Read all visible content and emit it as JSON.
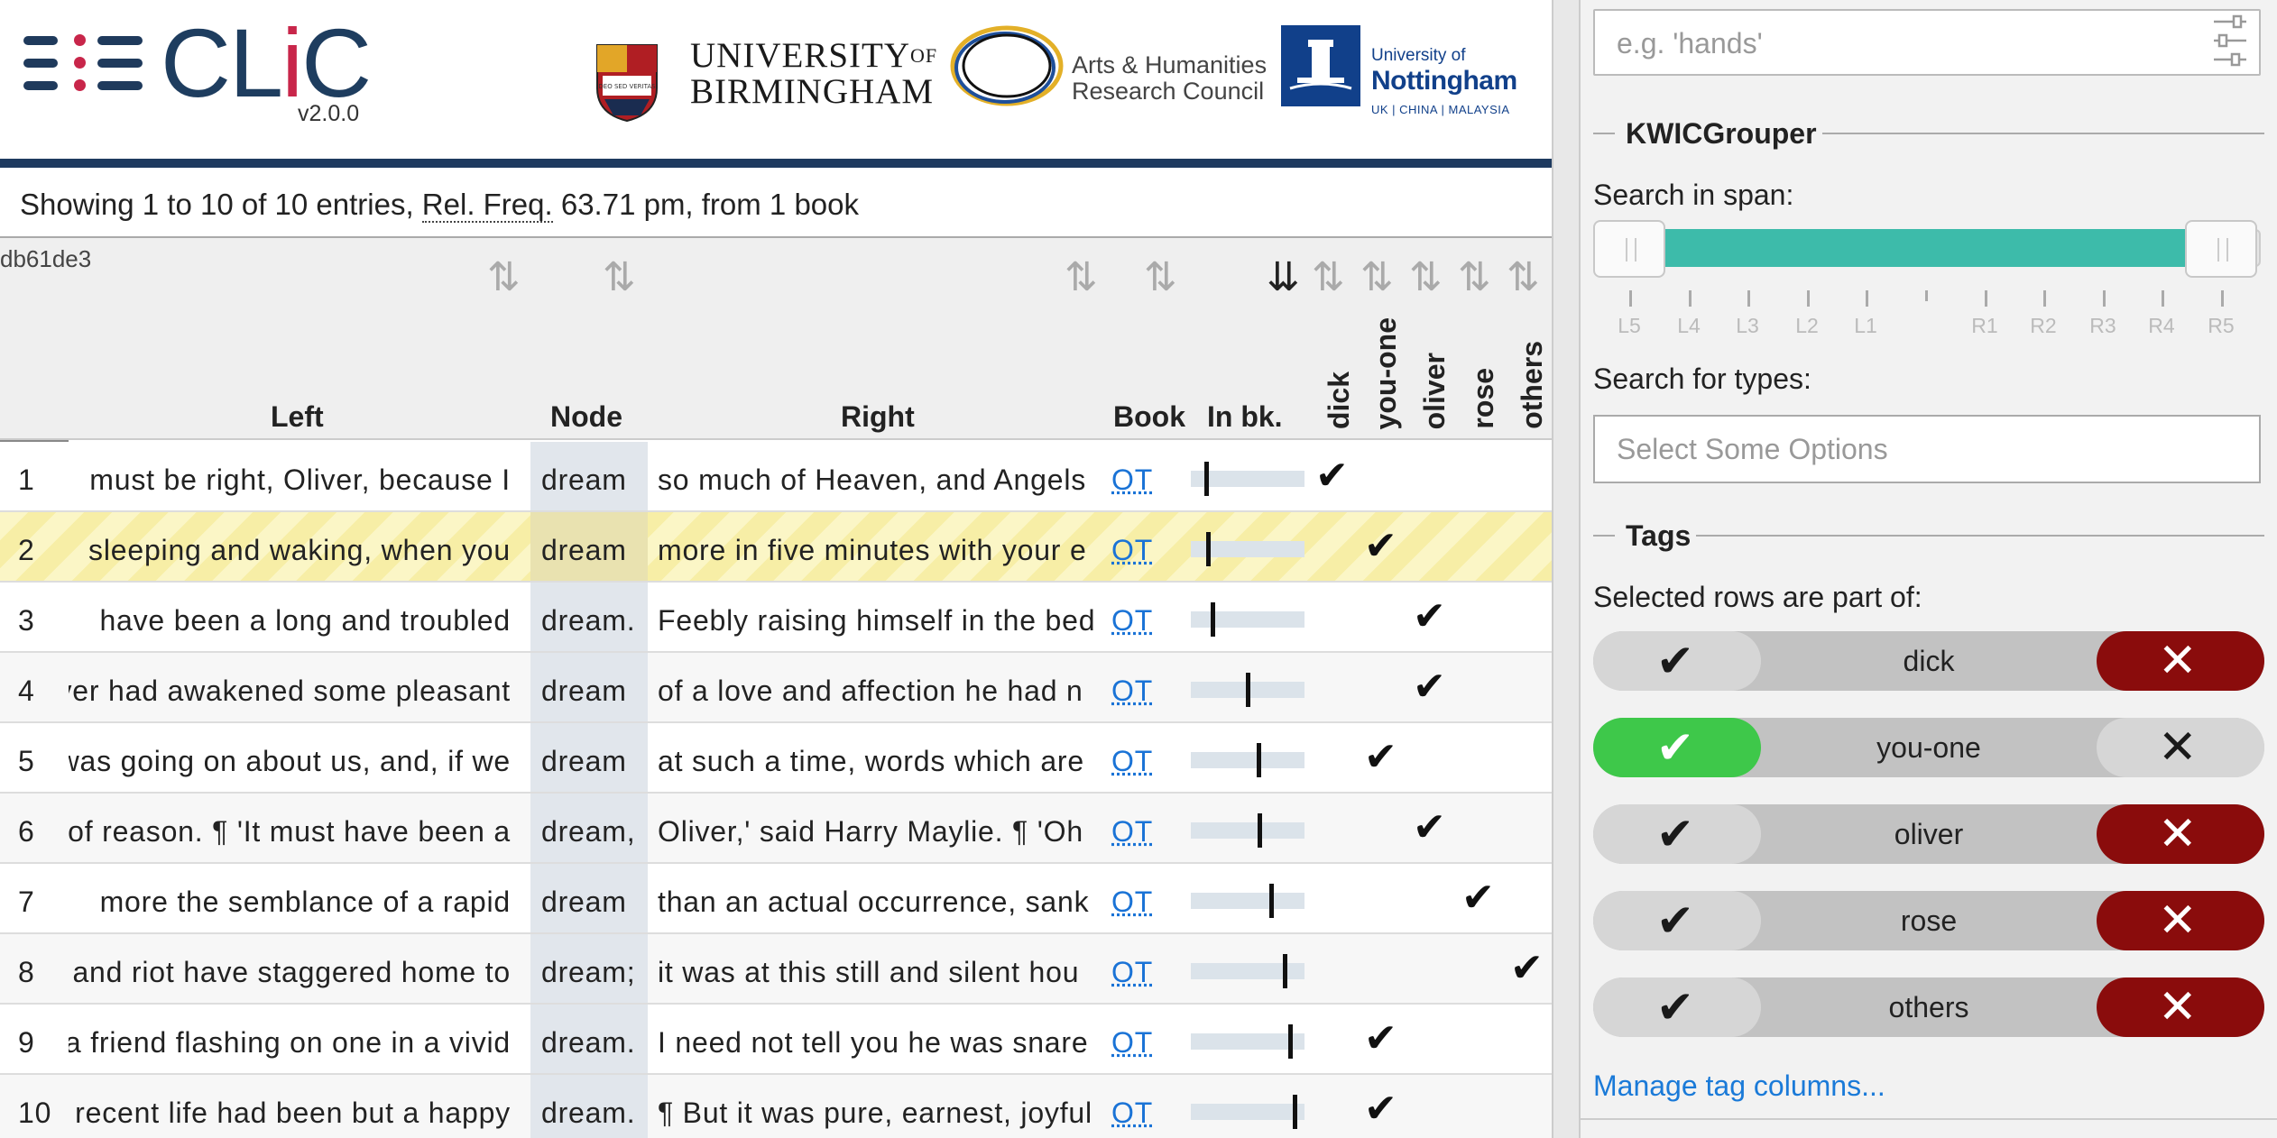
{
  "header": {
    "app_name_pre": "CL",
    "app_name_i": "i",
    "app_name_post": "C",
    "version": "v2.0.0",
    "uob_line1": "UNIVERSITY",
    "uob_of": "OF",
    "uob_line2": "BIRMINGHAM",
    "ahrc_line1": "Arts & Humanities",
    "ahrc_line2": "Research Council",
    "uon_line1": "University of",
    "uon_line2": "Nottingham",
    "uon_line3": "UK | CHINA | MALAYSIA",
    "uob_crest_text": "DEO SED VERITAS",
    "brand_color": "#1e3d5f",
    "accent_color": "#c8264a"
  },
  "info": {
    "text_prefix": "Showing 1 to 10 of 10 entries, ",
    "abbr": "Rel. Freq.",
    "text_suffix": " 63.71 pm, from 1 book"
  },
  "table": {
    "row_id": "db61de3",
    "headers": {
      "left": "Left",
      "node": "Node",
      "right": "Right",
      "book": "Book",
      "inbk": "In bk.",
      "tags": [
        "dick",
        "you-one",
        "oliver",
        "rose",
        "others"
      ]
    },
    "rows": [
      {
        "idx": "1",
        "left": "must be right, Oliver, because I",
        "node": "dream",
        "right": "so much of Heaven, and Angels",
        "book": "OT",
        "inbk": 0.12,
        "tag": 0
      },
      {
        "idx": "2",
        "left": "sleeping and waking, when you",
        "node": "dream",
        "right": "more in five minutes with your e",
        "book": "OT",
        "inbk": 0.14,
        "tag": 1
      },
      {
        "idx": "3",
        "left": "have been a long and troubled",
        "node": "dream.",
        "right": "Feebly raising himself in the bed",
        "book": "OT",
        "inbk": 0.18,
        "tag": 2
      },
      {
        "idx": "4",
        "left": "Oliver had awakened some pleasant",
        "node": "dream",
        "right": "of a love and affection he had n",
        "book": "OT",
        "inbk": 0.5,
        "tag": 2
      },
      {
        "idx": "5",
        "left": "It was going on about us, and, if we",
        "node": "dream",
        "right": "at such a time, words which are",
        "book": "OT",
        "inbk": 0.6,
        "tag": 1
      },
      {
        "idx": "6",
        "left": "out of reason. ¶ 'It must have been a",
        "node": "dream,",
        "right": "Oliver,' said Harry Maylie. ¶ 'Oh",
        "book": "OT",
        "inbk": 0.61,
        "tag": 2
      },
      {
        "idx": "7",
        "left": "more the semblance of a rapid",
        "node": "dream",
        "right": "than an actual occurrence, sank",
        "book": "OT",
        "inbk": 0.72,
        "tag": 3
      },
      {
        "idx": "8",
        "left": "and riot have staggered home to",
        "node": "dream;",
        "right": "it was at this still and silent hou",
        "book": "OT",
        "inbk": 0.84,
        "tag": 4
      },
      {
        "idx": "9",
        "left": "a friend flashing on one in a vivid",
        "node": "dream.",
        "right": "I need not tell you he was snare",
        "book": "OT",
        "inbk": 0.89,
        "tag": 1
      },
      {
        "idx": "10",
        "left": "her recent life had been but a happy",
        "node": "dream.",
        "right": "¶ But it was pure, earnest, joyful",
        "book": "OT",
        "inbk": 0.93,
        "tag": 1
      }
    ]
  },
  "panel": {
    "kwic_placeholder": "e.g. 'hands'",
    "kwicgrouper_title": "KWICGrouper",
    "search_span_label": "Search in span:",
    "span_labels": [
      "L5",
      "L4",
      "L3",
      "L2",
      "L1",
      "R1",
      "R2",
      "R3",
      "R4",
      "R5"
    ],
    "span_selected": [
      "L5",
      "R5"
    ],
    "search_types_label": "Search for types:",
    "types_placeholder": "Select Some Options",
    "tags_title": "Tags",
    "selected_rows_label": "Selected rows are part of:",
    "tags": [
      {
        "name": "dick",
        "state": "exclude"
      },
      {
        "name": "you-one",
        "state": "include"
      },
      {
        "name": "oliver",
        "state": "exclude"
      },
      {
        "name": "rose",
        "state": "exclude"
      },
      {
        "name": "others",
        "state": "exclude"
      }
    ],
    "manage_link": "Manage tag columns...",
    "slider_color": "#3dbbaa",
    "include_color": "#3ec84a",
    "exclude_color": "#8a0c0c",
    "check_glyph": "✔",
    "cross_glyph": "✕"
  }
}
